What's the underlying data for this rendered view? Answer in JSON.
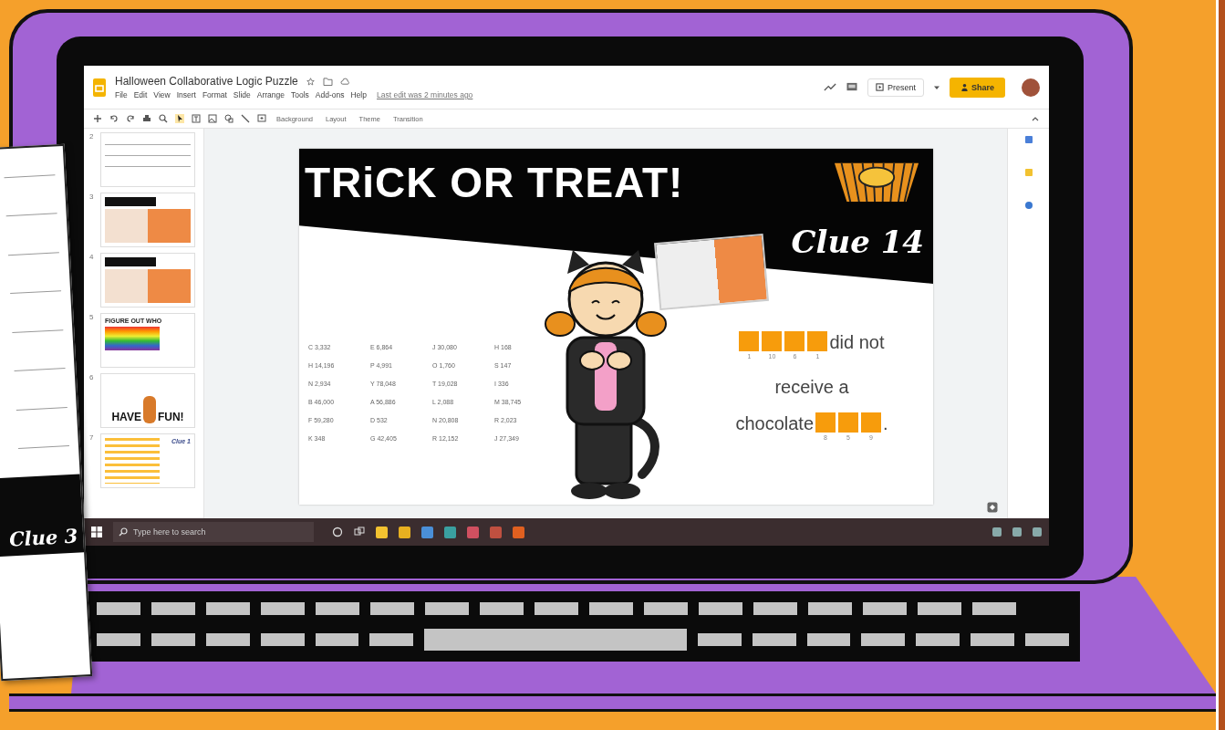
{
  "worksheet": {
    "clue": "Clue 3"
  },
  "app": {
    "title": "Halloween Collaborative Logic Puzzle",
    "menu": [
      "File",
      "Edit",
      "View",
      "Insert",
      "Format",
      "Slide",
      "Arrange",
      "Tools",
      "Add-ons",
      "Help"
    ],
    "last_edit": "Last edit was 2 minutes ago",
    "present": "Present",
    "share": "Share"
  },
  "toolbar": {
    "buttons": [
      "Background",
      "Layout",
      "Theme",
      "Transition"
    ]
  },
  "thumbnails": [
    {
      "number": "2",
      "kind": "worksheet"
    },
    {
      "number": "3",
      "kind": "banner"
    },
    {
      "number": "4",
      "kind": "banner"
    },
    {
      "number": "5",
      "kind": "rainbow",
      "text": "FIGURE OUT WHO"
    },
    {
      "number": "6",
      "kind": "fun",
      "text": "HAVE",
      "text2": "FUN!"
    },
    {
      "number": "7",
      "kind": "clue",
      "text": "Clue 1"
    }
  ],
  "slide": {
    "title": "TRiCK OR TREAT!",
    "clue": "Clue 14",
    "table": [
      [
        {
          "letter": "C",
          "value": "3,332"
        },
        {
          "letter": "E",
          "value": "6,864"
        },
        {
          "letter": "J",
          "value": "30,080"
        },
        {
          "letter": "H",
          "value": "168"
        }
      ],
      [
        {
          "letter": "H",
          "value": "14,196"
        },
        {
          "letter": "P",
          "value": "4,991"
        },
        {
          "letter": "O",
          "value": "1,760"
        },
        {
          "letter": "S",
          "value": "147"
        }
      ],
      [
        {
          "letter": "N",
          "value": "2,934"
        },
        {
          "letter": "Y",
          "value": "78,048"
        },
        {
          "letter": "T",
          "value": "19,028"
        },
        {
          "letter": "I",
          "value": "336"
        }
      ],
      [
        {
          "letter": "B",
          "value": "46,000"
        },
        {
          "letter": "A",
          "value": "56,886"
        },
        {
          "letter": "L",
          "value": "2,088"
        },
        {
          "letter": "M",
          "value": "38,745"
        }
      ],
      [
        {
          "letter": "F",
          "value": "59,280"
        },
        {
          "letter": "D",
          "value": "532"
        },
        {
          "letter": "N",
          "value": "20,808"
        },
        {
          "letter": "R",
          "value": "2,023"
        }
      ],
      [
        {
          "letter": "K",
          "value": "348"
        },
        {
          "letter": "G",
          "value": "42,405"
        },
        {
          "letter": "R",
          "value": "12,152"
        },
        {
          "letter": "J",
          "value": "27,349"
        }
      ]
    ],
    "line1": {
      "blanks": [
        "1",
        "10",
        "6",
        "1"
      ],
      "text": "did not"
    },
    "line2": "receive a",
    "line3": {
      "text": "chocolate",
      "blanks": [
        "8",
        "5",
        "9"
      ],
      "end": "."
    }
  },
  "taskbar": {
    "search_placeholder": "Type here to search"
  }
}
